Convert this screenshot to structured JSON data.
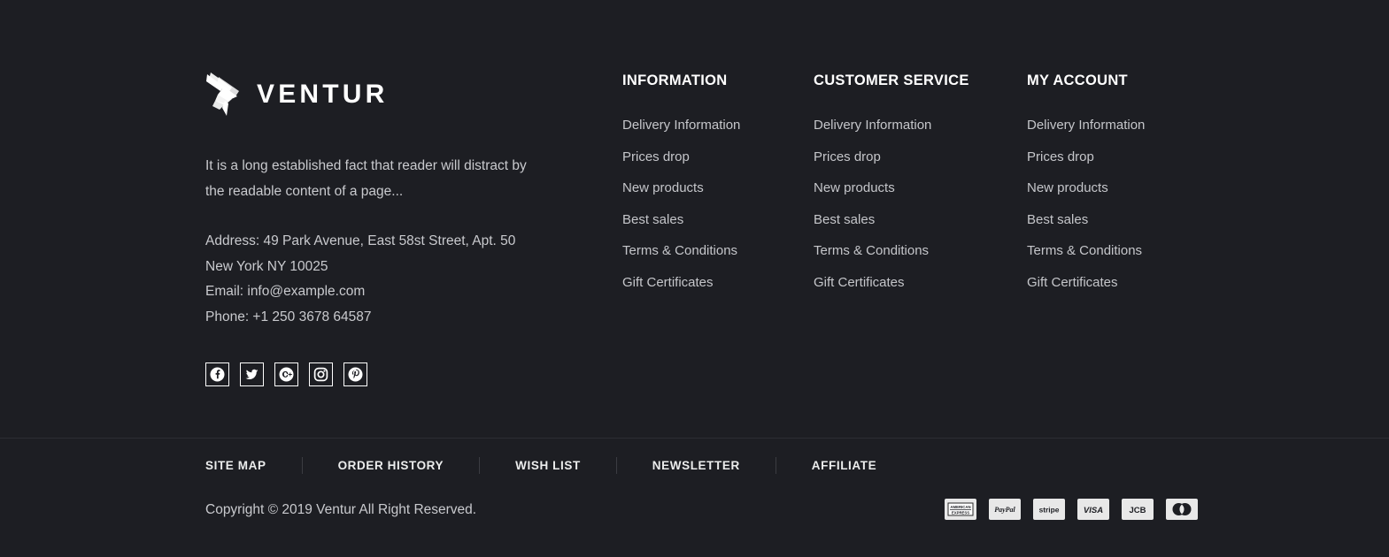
{
  "brand": {
    "logo_icon": "eagle-logo-icon",
    "name": "VENTUR",
    "about": "It is a long established fact that reader will distract by the readable content of a page...",
    "contact": [
      "Address: 49 Park Avenue, East 58st Street, Apt. 50",
      "New York NY 10025",
      "Email: info@example.com",
      "Phone: +1 250 3678 64587"
    ],
    "social": [
      {
        "name": "facebook",
        "icon": "facebook-icon"
      },
      {
        "name": "twitter",
        "icon": "twitter-icon"
      },
      {
        "name": "google-plus",
        "icon": "google-plus-icon"
      },
      {
        "name": "instagram",
        "icon": "instagram-icon"
      },
      {
        "name": "pinterest",
        "icon": "pinterest-icon"
      }
    ]
  },
  "columns": [
    {
      "title": "INFORMATION",
      "links": [
        "Delivery Information",
        "Prices drop",
        "New products",
        "Best sales",
        "Terms & Conditions",
        "Gift Certificates"
      ]
    },
    {
      "title": "CUSTOMER SERVICE",
      "links": [
        "Delivery Information",
        "Prices drop",
        "New products",
        "Best sales",
        "Terms & Conditions",
        "Gift Certificates"
      ]
    },
    {
      "title": "MY ACCOUNT",
      "links": [
        "Delivery Information",
        "Prices drop",
        "New products",
        "Best sales",
        "Terms & Conditions",
        "Gift Certificates"
      ]
    }
  ],
  "bottom_nav": [
    "SITE MAP",
    "ORDER HISTORY",
    "WISH LIST",
    "NEWSLETTER",
    "AFFILIATE"
  ],
  "copyright": "Copyright © 2019 Ventur All Right Reserved.",
  "payments": [
    {
      "name": "american-express",
      "label": "AMERICAN EXPRESS"
    },
    {
      "name": "paypal",
      "label": "PayPal"
    },
    {
      "name": "stripe",
      "label": "stripe"
    },
    {
      "name": "visa",
      "label": "VISA"
    },
    {
      "name": "jcb",
      "label": "JCB"
    },
    {
      "name": "maestro",
      "label": "Maestro"
    }
  ],
  "colors": {
    "background": "#1d1e23",
    "heading": "#ffffff",
    "body_text": "#c9cace",
    "divider": "#2c2d33",
    "badge_bg": "#e8e8e8"
  }
}
